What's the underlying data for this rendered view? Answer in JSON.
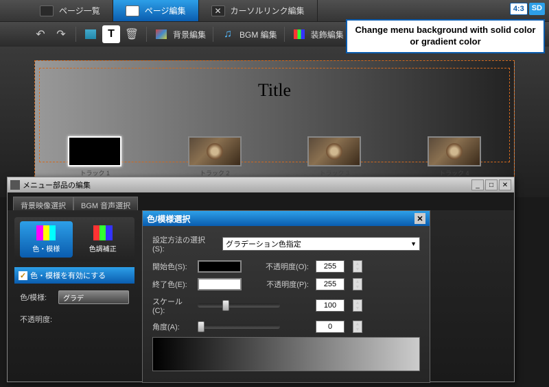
{
  "topTabs": {
    "list": "ページ一覧",
    "edit": "ページ編集",
    "cursor": "カーソルリンク編集"
  },
  "badges": {
    "ratio": "4:3",
    "sd": "SD"
  },
  "callout": "Change menu background with solid color or gradient color",
  "toolbar": {
    "bgEdit": "背景編集",
    "bgmEdit": "BGM 編集",
    "decoEdit": "装飾編集"
  },
  "canvas": {
    "title": "Title",
    "tracks": [
      "トラック 1",
      "トラック 2",
      "トラック 3",
      "トラック 4"
    ]
  },
  "dialog": {
    "title": "メニュー部品の編集",
    "tabs": {
      "bgVideo": "背景映像選択",
      "bgmAudio": "BGM 音声選択"
    },
    "modes": {
      "colorPattern": "色・模様",
      "colorAdjust": "色調補正"
    },
    "enableLabel": "色・模様を有効にする",
    "leftFields": {
      "colorPattern": "色/模様:",
      "opacity": "不透明度:",
      "gradBtn": "グラデ"
    }
  },
  "subDialog": {
    "title": "色/模様選択",
    "methodLabel": "設定方法の選択(S):",
    "methodValue": "グラデーション色指定",
    "startColor": "開始色(S):",
    "endColor": "終了色(E):",
    "scale": "スケール(C):",
    "angle": "角度(A):",
    "opacityO": "不透明度(O):",
    "opacityP": "不透明度(P):",
    "values": {
      "op1": "255",
      "op2": "255",
      "scale": "100",
      "angle": "0"
    }
  }
}
